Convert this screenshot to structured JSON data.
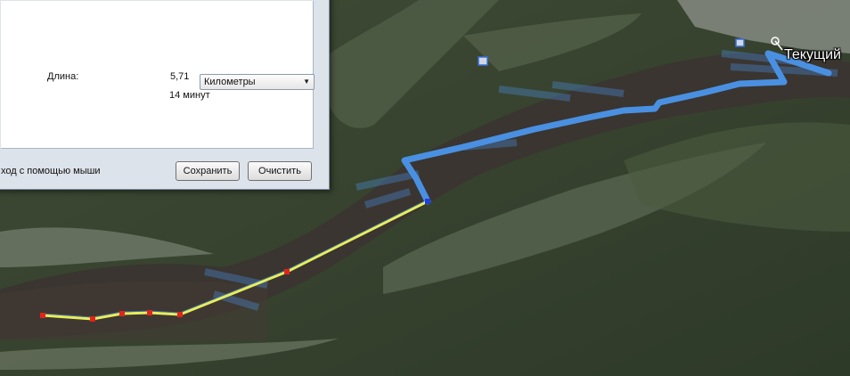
{
  "map": {
    "place_label": "Текущий"
  },
  "ruler": {
    "length_label": "Длина:",
    "length_value": "5,71",
    "units_selected": "Километры",
    "time_value": "14 минут",
    "hint": "ход с помощью мыши",
    "save_label": "Сохранить",
    "clear_label": "Очистить"
  },
  "colors": {
    "track": "#4a90e2",
    "measure_line": "#e8ee5a",
    "measure_point": "#e0241c",
    "end_point": "#1f3fe0"
  }
}
